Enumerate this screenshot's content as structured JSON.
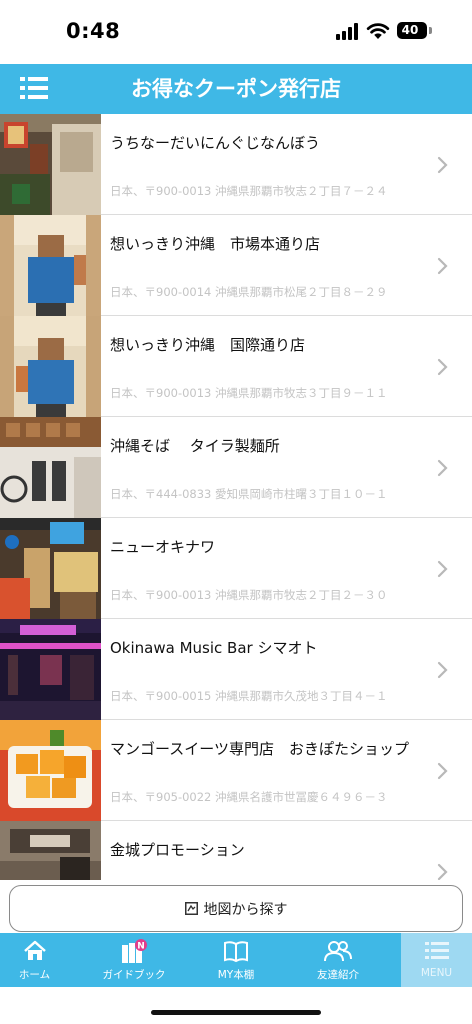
{
  "status_bar": {
    "time": "0:48",
    "battery": "40"
  },
  "header": {
    "title": "お得なクーポン発行店",
    "menu_icon": "list-menu-icon"
  },
  "stores": [
    {
      "name": "うちなーだいにんぐじなんぼう",
      "address": "日本、〒900-0013 沖縄県那覇市牧志２丁目７－２４"
    },
    {
      "name": "想いっきり沖縄　市場本通り店",
      "address": "日本、〒900-0014 沖縄県那覇市松尾２丁目８－２９"
    },
    {
      "name": "想いっきり沖縄　国際通り店",
      "address": "日本、〒900-0013 沖縄県那覇市牧志３丁目９－１１"
    },
    {
      "name": "沖縄そば　 タイラ製麺所",
      "address": "日本、〒444-0833 愛知県岡崎市柱曙３丁目１０－１"
    },
    {
      "name": "ニューオキナワ",
      "address": "日本、〒900-0013 沖縄県那覇市牧志２丁目２－３０"
    },
    {
      "name": "Okinawa Music Bar シマオト",
      "address": "日本、〒900-0015 沖縄県那覇市久茂地３丁目４－１"
    },
    {
      "name": "マンゴースイーツ専門店　おきぽたショップ",
      "address": "日本、〒905-0022 沖縄県名護市世冨慶６４９６－３"
    },
    {
      "name": "金城プロモーション",
      "address": ""
    }
  ],
  "map_search": {
    "label": "地図から探す",
    "icon": "map-icon"
  },
  "tabs": [
    {
      "label": "ホーム",
      "icon": "home-icon"
    },
    {
      "label": "ガイドブック",
      "icon": "guidebook-icon",
      "badge": "N"
    },
    {
      "label": "MY本棚",
      "icon": "book-icon"
    },
    {
      "label": "友達紹介",
      "icon": "friends-icon"
    },
    {
      "label": "MENU",
      "icon": "menu-icon",
      "active": true
    }
  ],
  "colors": {
    "accent": "#3fb8e6",
    "active_tab": "#9ed9f2",
    "address_gray": "#c4c4c4",
    "badge": "#e23d8b"
  }
}
